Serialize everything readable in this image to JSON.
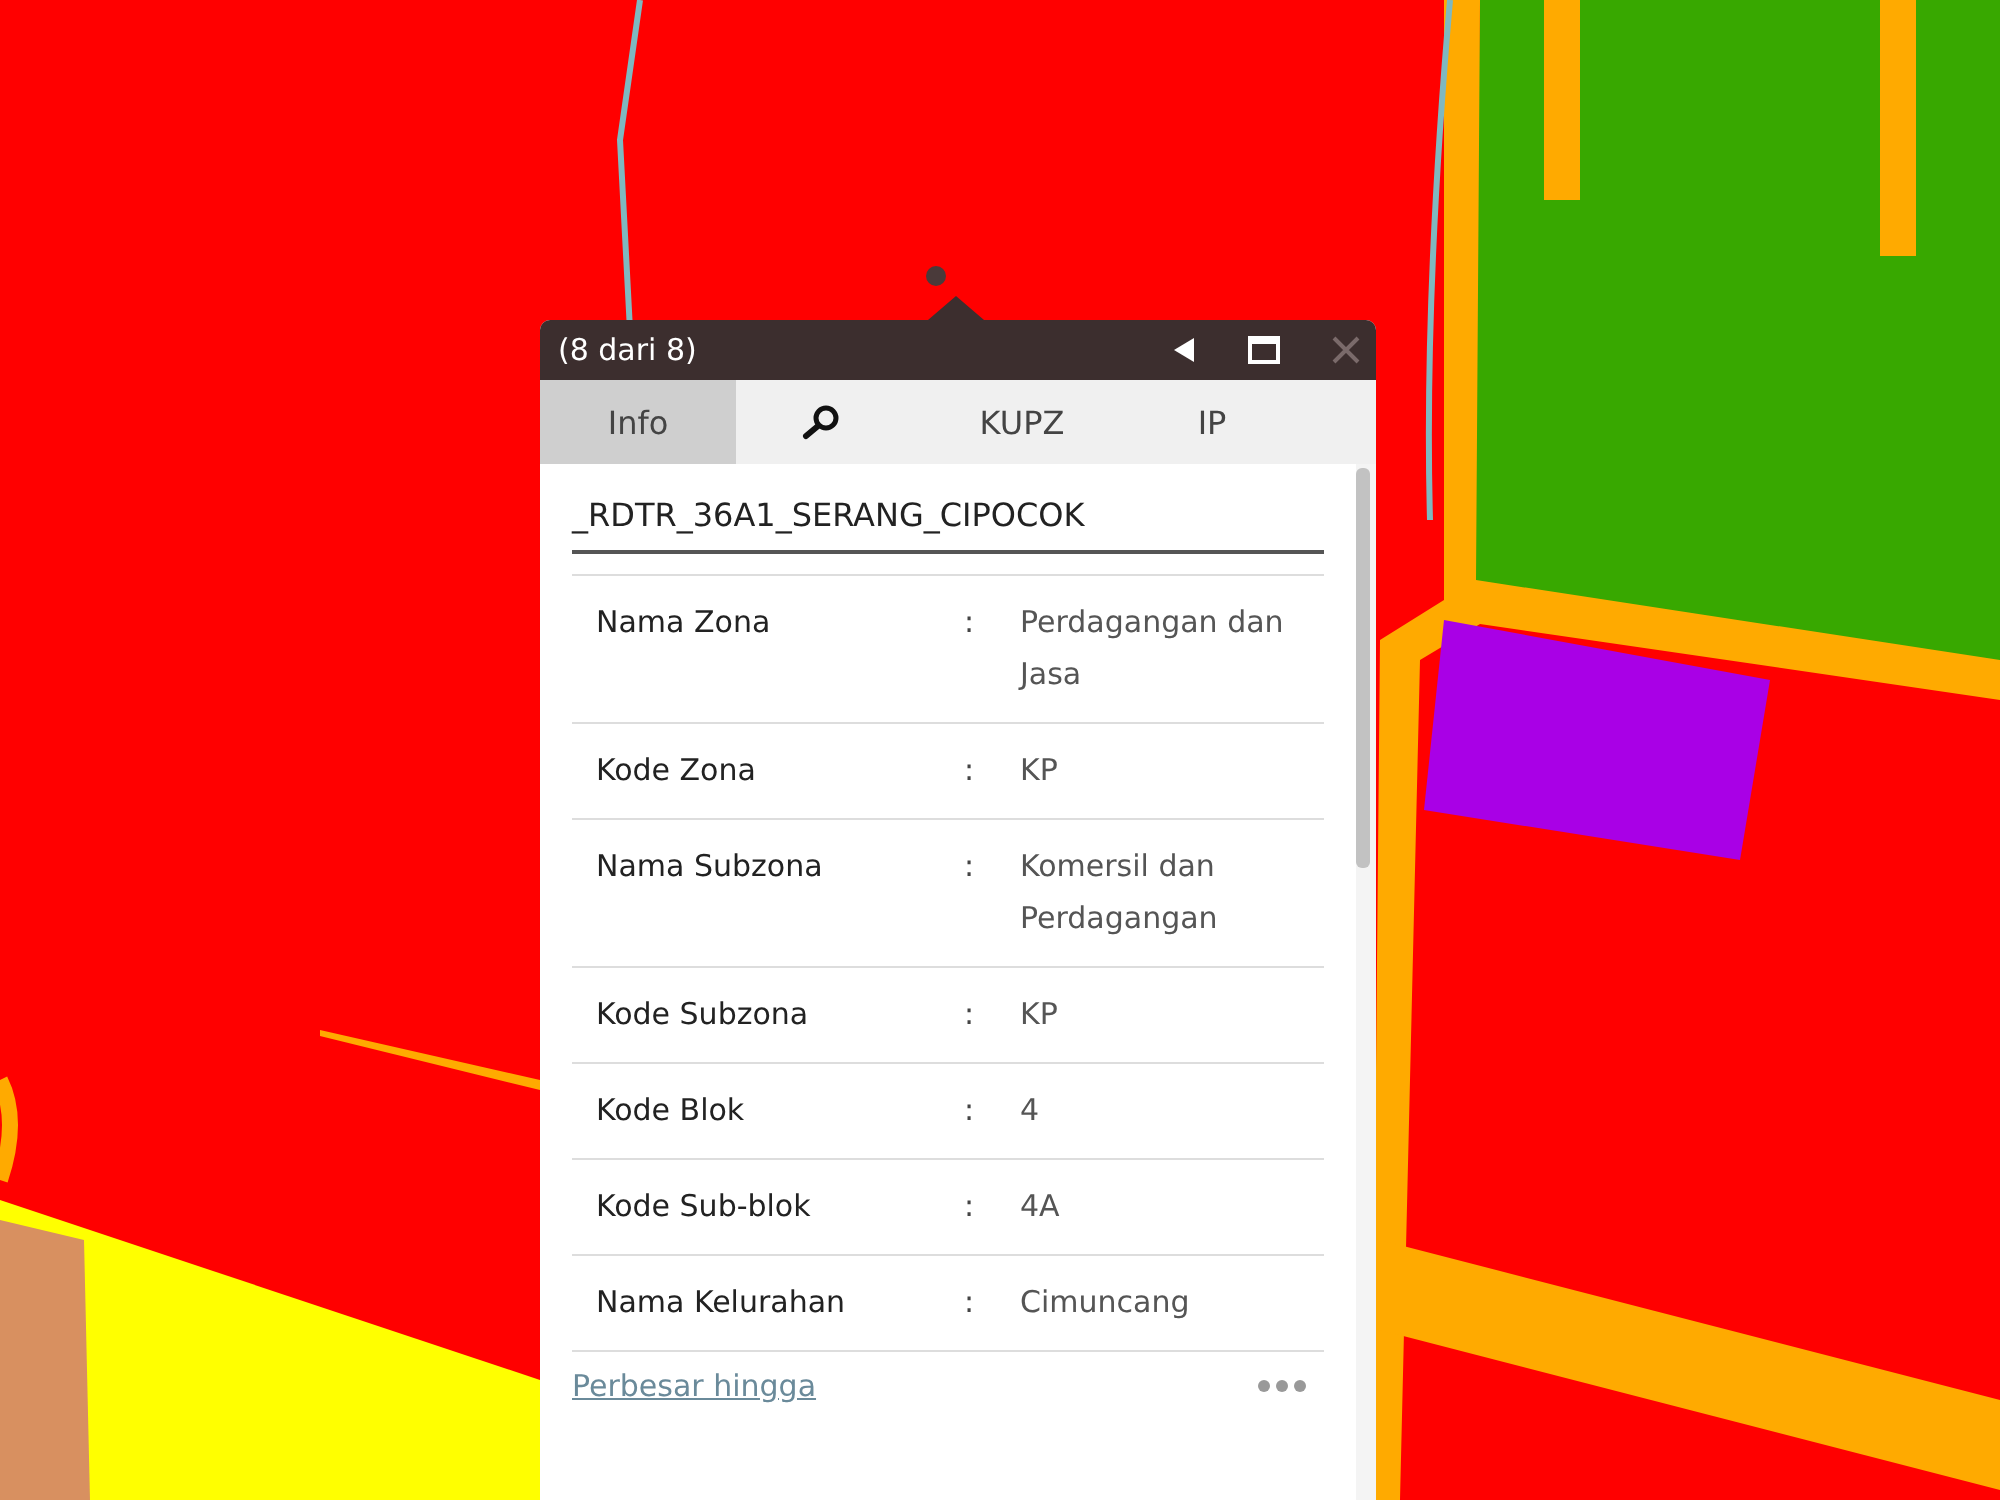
{
  "popup": {
    "title": "(8 dari 8)",
    "close_disabled": true,
    "tabs": [
      {
        "kind": "text",
        "label": "Info",
        "selected": true
      },
      {
        "kind": "search",
        "selected": false
      },
      {
        "kind": "text",
        "label": "KUPZ",
        "selected": false
      },
      {
        "kind": "text",
        "label": "IP",
        "selected": false
      }
    ],
    "feature_title": "_RDTR_36A1_SERANG_CIPOCOK",
    "rows": [
      {
        "label": "Nama Zona",
        "separator": ":",
        "value": "Perdagangan dan Jasa"
      },
      {
        "label": "Kode Zona",
        "separator": ":",
        "value": "KP"
      },
      {
        "label": "Nama Subzona",
        "separator": ":",
        "value": "Komersil dan Perdagangan"
      },
      {
        "label": "Kode Subzona",
        "separator": ":",
        "value": "KP"
      },
      {
        "label": "Kode Blok",
        "separator": ":",
        "value": "4"
      },
      {
        "label": "Kode Sub-blok",
        "separator": ":",
        "value": "4A"
      },
      {
        "label": "Nama Kelurahan",
        "separator": ":",
        "value": "Cimuncang"
      }
    ],
    "footer_link": "Perbesar hingga"
  }
}
